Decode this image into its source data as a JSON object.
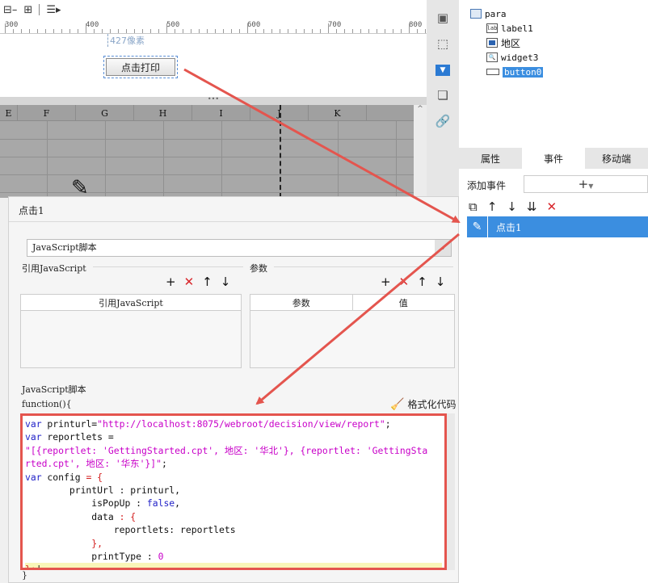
{
  "designer": {
    "toolbar_icons": [
      "param-toggle-icon",
      "tree-layout-icon",
      "list-menu-icon"
    ],
    "ruler_labels": [
      "300",
      "400",
      "500",
      "600",
      "700",
      "800"
    ],
    "pixel_hint": "427像素",
    "print_button_label": "点击打印",
    "splitter_grip": "•••",
    "columns": [
      "E",
      "F",
      "G",
      "H",
      "I",
      "J",
      "K"
    ]
  },
  "widget_tree": {
    "items": [
      {
        "label": "para",
        "icon": "root-form-icon"
      },
      {
        "label": "label1",
        "icon": "label-widget-icon"
      },
      {
        "label": "地区",
        "icon": "combobox-widget-icon"
      },
      {
        "label": "widget3",
        "icon": "search-widget-icon"
      },
      {
        "label": "button0",
        "icon": "button-widget-icon",
        "selected": true
      }
    ]
  },
  "property_panel": {
    "tabs": [
      {
        "label": "属性",
        "active": false
      },
      {
        "label": "事件",
        "active": true
      },
      {
        "label": "移动端",
        "active": false
      }
    ],
    "add_event_label": "添加事件",
    "add_event_button": "+",
    "event_row_label": "点击1"
  },
  "dialog": {
    "title": "点击1",
    "script_type": "JavaScript脚本",
    "ref_js_title": "引用JavaScript",
    "params_title": "参数",
    "ref_js_header": "引用JavaScript",
    "params_header_1": "参数",
    "params_header_2": "值",
    "js_script_title": "JavaScript脚本",
    "function_head": "function(){",
    "format_label": "格式化代码",
    "function_close": "}"
  },
  "code": {
    "l1_kw": "var",
    "l1_name": " printurl=",
    "l1_str": "\"http://localhost:8075/webroot/decision/view/report\"",
    "l1_end": ";",
    "l2_kw": "var",
    "l2_name": " reportlets =",
    "l3_str": "\"[{reportlet: 'GettingStarted.cpt', 地区: '华北'}, {reportlet: 'GettingSta",
    "l4_str": "rted.cpt', 地区: '华东'}]\"",
    "l4_end": ";",
    "l5_kw": "var",
    "l5_name": " config ",
    "l5_op": "= {",
    "l6": "        printUrl : printurl,",
    "l7_a": "            isPopUp : ",
    "l7_kw": "false",
    "l7_b": ",",
    "l8_a": "            data ",
    "l8_op": ": {",
    "l9": "                reportlets: reportlets",
    "l10_op": "            },",
    "l11_a": "            printType : ",
    "l11_num": "0",
    "l12_op": "};"
  },
  "colors": {
    "accent": "#3b8ee0",
    "annotation": "#e4554e",
    "delete_red": "#d8262b"
  }
}
